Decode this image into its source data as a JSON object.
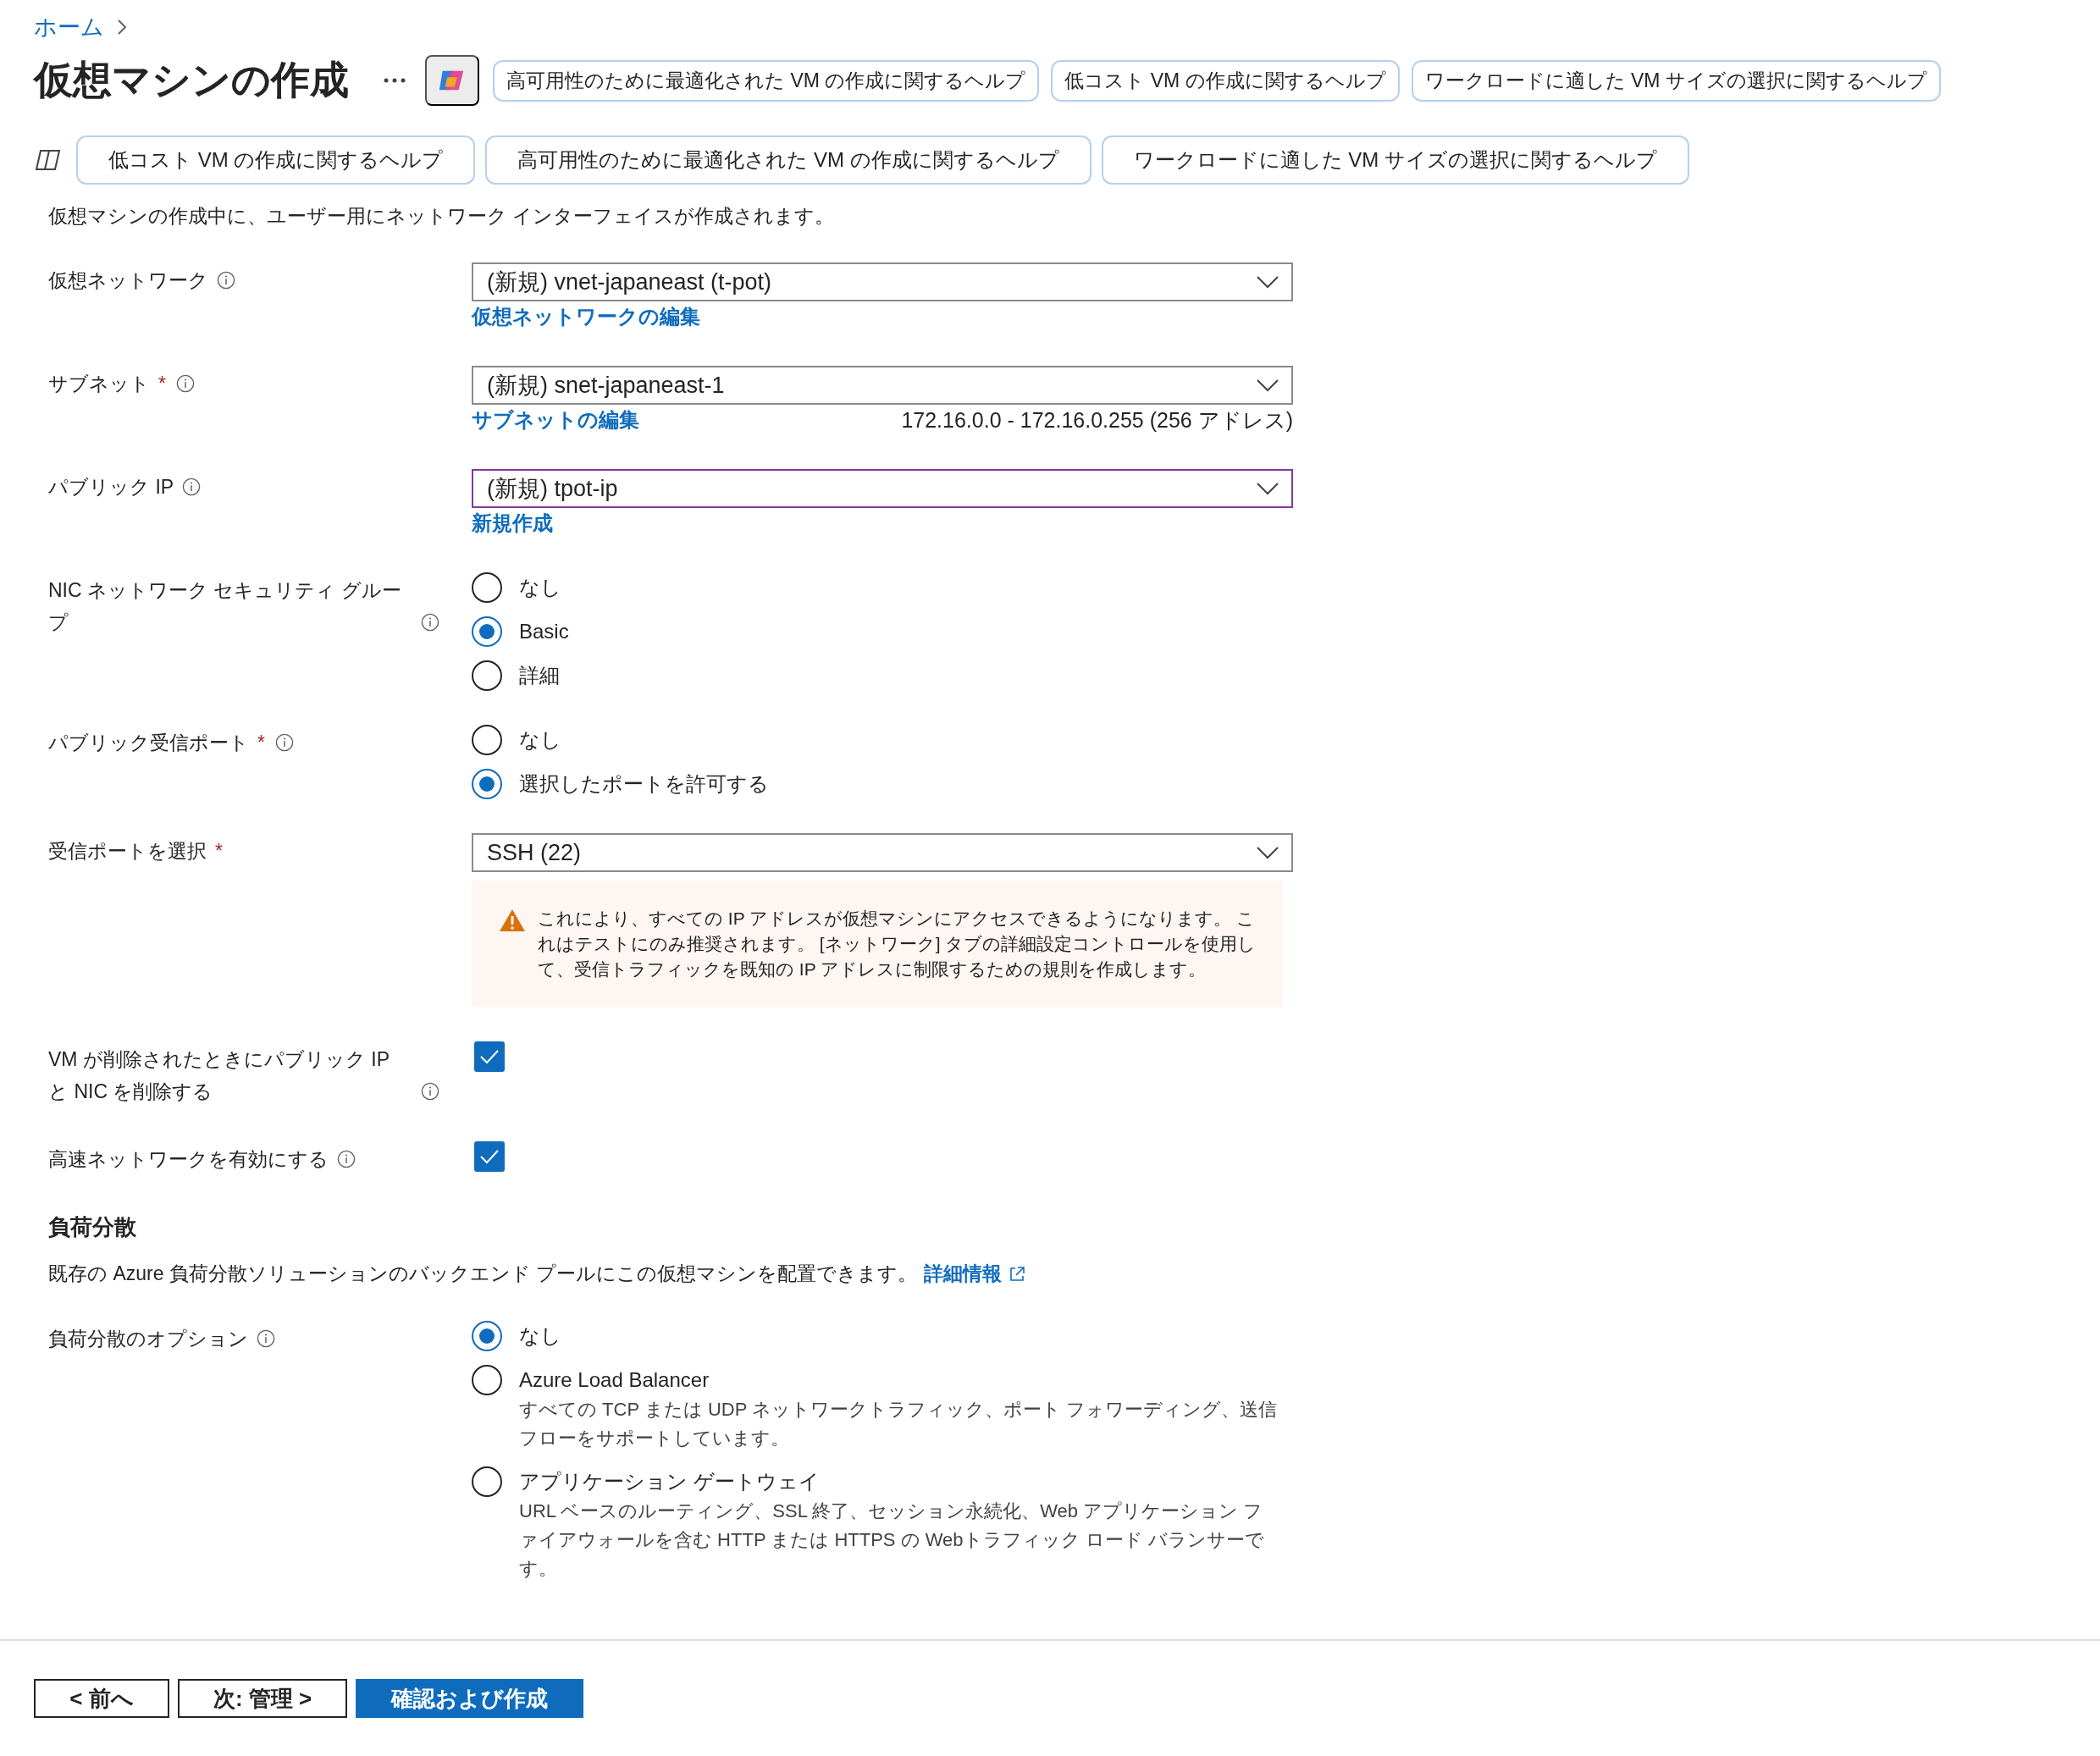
{
  "breadcrumb": [
    {
      "label": "ホーム"
    }
  ],
  "title": "仮想マシンの作成",
  "header_help": [
    {
      "label": "高可用性のために最適化された VM の作成に関するヘルプ"
    },
    {
      "label": "低コスト VM の作成に関するヘルプ"
    },
    {
      "label": "ワークロードに適した VM サイズの選択に関するヘルプ"
    }
  ],
  "help_suggestions": [
    {
      "label": "低コスト VM の作成に関するヘルプ"
    },
    {
      "label": "高可用性のために最適化された VM の作成に関するヘルプ"
    },
    {
      "label": "ワークロードに適した VM サイズの選択に関するヘルプ"
    }
  ],
  "intro_text": "仮想マシンの作成中に、ユーザー用にネットワーク インターフェイスが作成されます。",
  "fields": [
    {
      "kind": "dropdown",
      "label": "仮想ネットワーク",
      "info": true,
      "value": "(新規) vnet-japaneast (t-pot)",
      "focused": false,
      "link": "仮想ネットワークの編集"
    },
    {
      "kind": "dropdown",
      "label": "サブネット",
      "required_mark": "*",
      "info": true,
      "value": "(新規) snet-japaneast-1",
      "focused": false,
      "link": "サブネットの編集",
      "note": "172.16.0.0 - 172.16.0.255 (256 アドレス)"
    },
    {
      "kind": "dropdown",
      "label": "パブリック IP",
      "info": true,
      "value": "(新規) tpot-ip",
      "focused": true,
      "link": "新規作成"
    },
    {
      "kind": "radio",
      "label": "NIC ネットワーク セキュリティ グループ",
      "info": true,
      "options": [
        {
          "label": "なし",
          "selected": false
        },
        {
          "label": "Basic",
          "selected": true
        },
        {
          "label": "詳細",
          "selected": false
        }
      ]
    },
    {
      "kind": "radio",
      "label": "パブリック受信ポート",
      "required_mark": "*",
      "info": true,
      "options": [
        {
          "label": "なし",
          "selected": false
        },
        {
          "label": "選択したポートを許可する",
          "selected": true
        }
      ]
    },
    {
      "kind": "dropdown",
      "label": "受信ポートを選択",
      "required_mark": "*",
      "info": false,
      "value": "SSH (22)",
      "focused": false,
      "warning": "これにより、すべての IP アドレスが仮想マシンにアクセスできるようになります。 これはテストにのみ推奨されます。 [ネットワーク] タブの詳細設定コントロールを使用して、受信トラフィックを既知の IP アドレスに制限するための規則を作成します。"
    },
    {
      "kind": "checkbox",
      "label": "VM が削除されたときにパブリック IP と NIC を削除する",
      "info": true,
      "checked": true
    },
    {
      "kind": "checkbox",
      "label": "高速ネットワークを有効にする",
      "info": true,
      "checked": true
    }
  ],
  "load_balancing": {
    "heading": "負荷分散",
    "description": "既存の Azure 負荷分散ソリューションのバックエンド プールにこの仮想マシンを配置できます。",
    "link": "詳細情報",
    "fields": [
      {
        "kind": "radio",
        "label": "負荷分散のオプション",
        "info": true,
        "options": [
          {
            "label": "なし",
            "selected": true
          },
          {
            "label": "Azure Load Balancer",
            "selected": false,
            "description": "すべての TCP または UDP ネットワークトラフィック、ポート フォワーディング、送信フローをサポートしています。"
          },
          {
            "label": "アプリケーション ゲートウェイ",
            "selected": false,
            "description": "URL ベースのルーティング、SSL 終了、セッション永続化、Web アプリケーション ファイアウォールを含む HTTP または HTTPS の Webトラフィック ロード バランサーです。"
          }
        ]
      }
    ]
  },
  "footer_buttons": [
    {
      "label": "< 前へ",
      "kind": "secondary"
    },
    {
      "label": "次: 管理 >",
      "kind": "secondary"
    },
    {
      "label": "確認および作成",
      "kind": "primary"
    }
  ]
}
